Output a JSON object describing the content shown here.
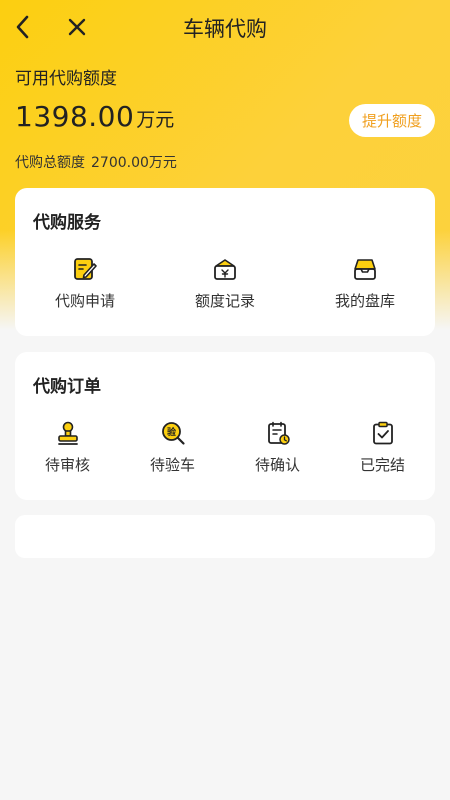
{
  "header": {
    "title": "车辆代购"
  },
  "quota": {
    "available_label": "可用代购额度",
    "available_amount": "1398.00",
    "available_unit": "万元",
    "upgrade_label": "提升额度",
    "total_label": "代购总额度",
    "total_value": "2700.00万元"
  },
  "service": {
    "title": "代购服务",
    "items": [
      {
        "label": "代购申请",
        "icon": "edit-icon"
      },
      {
        "label": "额度记录",
        "icon": "ticket-box-icon"
      },
      {
        "label": "我的盘库",
        "icon": "inbox-icon"
      }
    ]
  },
  "orders": {
    "title": "代购订单",
    "items": [
      {
        "label": "待审核",
        "icon": "stamp-icon"
      },
      {
        "label": "待验车",
        "icon": "inspect-icon",
        "glyph": "验"
      },
      {
        "label": "待确认",
        "icon": "clipboard-clock-icon"
      },
      {
        "label": "已完结",
        "icon": "clipboard-check-icon"
      }
    ]
  },
  "colors": {
    "accent": "#fccf10",
    "accent_dark": "#f5a623",
    "upgrade_text": "#f0a020"
  }
}
